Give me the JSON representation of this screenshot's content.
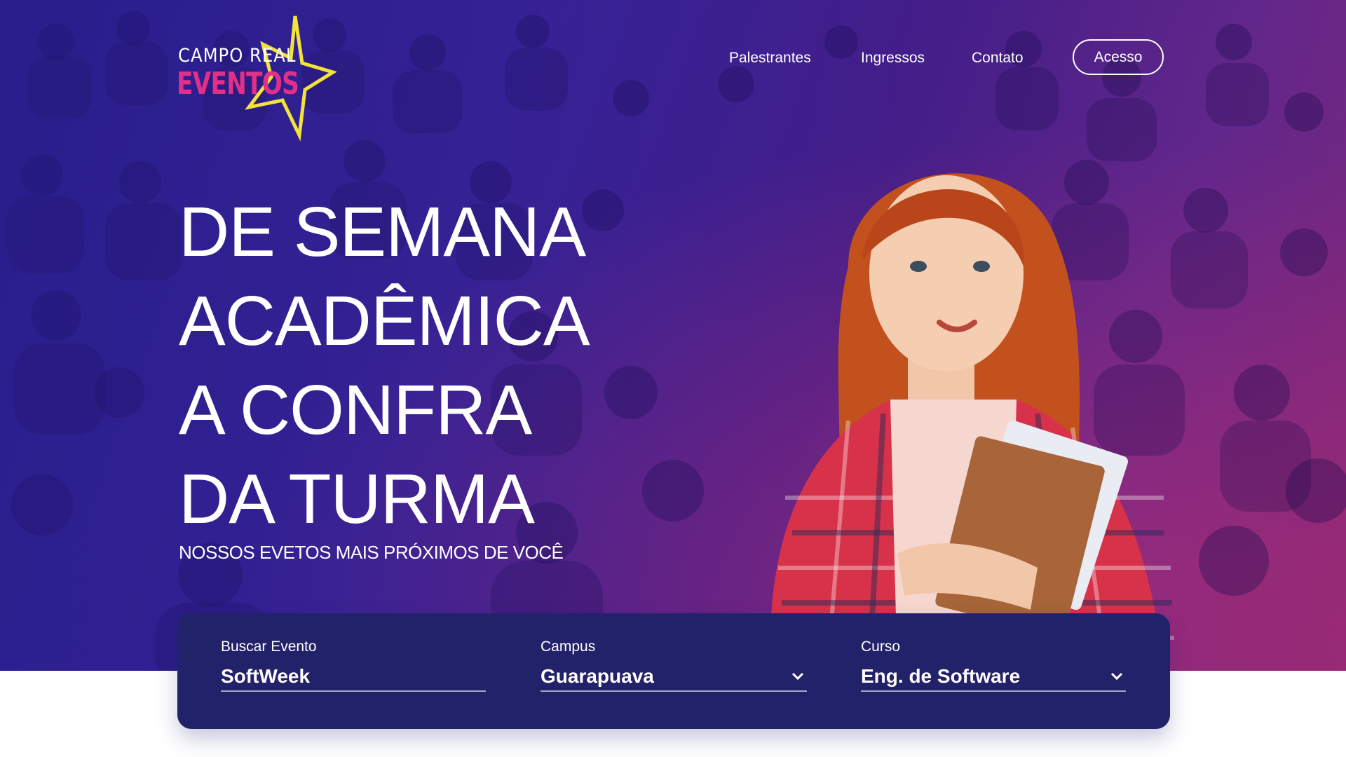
{
  "logo": {
    "line1": "CAMPO REAL",
    "line2": "EVENTOS"
  },
  "nav": {
    "links": [
      "Palestrantes",
      "Ingressos",
      "Contato"
    ],
    "cta": "Acesso"
  },
  "hero": {
    "headline": [
      "DE SEMANA",
      "ACADÊMICA",
      "A CONFRA",
      "DA TURMA"
    ],
    "subtitle": "NOSSOS EVETOS MAIS PRÓXIMOS DE VOCÊ"
  },
  "search": {
    "event": {
      "label": "Buscar Evento",
      "value": "SoftWeek"
    },
    "campus": {
      "label": "Campus",
      "value": "Guarapuava"
    },
    "course": {
      "label": "Curso",
      "value": "Eng. de Software"
    }
  },
  "colors": {
    "accent_pink": "#e0308a",
    "star_yellow": "#f2e23a",
    "search_bar": "#22226a",
    "hero_purple": "#3b2399"
  }
}
